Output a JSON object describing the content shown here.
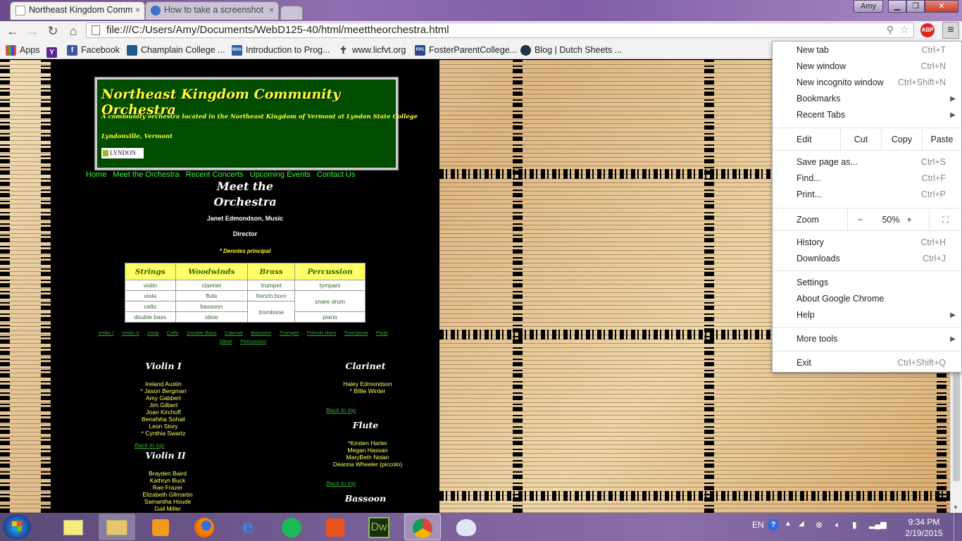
{
  "browser": {
    "tabs": [
      {
        "title": "Northeast Kingdom Comm"
      },
      {
        "title": "How to take a screenshot"
      }
    ],
    "user": "Amy",
    "url": "file:///C:/Users/Amy/Documents/WebD125-40/html/meettheorchestra.html",
    "bookmarks": [
      {
        "label": "Apps"
      },
      {
        "label": "Y"
      },
      {
        "label": "Facebook"
      },
      {
        "label": "Champlain College ..."
      },
      {
        "label": "Introduction to Prog..."
      },
      {
        "label": "www.licfvt.org"
      },
      {
        "label": "FosterParentCollege..."
      },
      {
        "label": "Blog | Dutch Sheets ..."
      }
    ]
  },
  "menu": {
    "new_tab": "New tab",
    "new_tab_sc": "Ctrl+T",
    "new_window": "New window",
    "new_window_sc": "Ctrl+N",
    "incognito": "New incognito window",
    "incognito_sc": "Ctrl+Shift+N",
    "bookmarks": "Bookmarks",
    "recent_tabs": "Recent Tabs",
    "edit": "Edit",
    "cut": "Cut",
    "copy": "Copy",
    "paste": "Paste",
    "save_page": "Save page as...",
    "save_page_sc": "Ctrl+S",
    "find": "Find...",
    "find_sc": "Ctrl+F",
    "print": "Print...",
    "print_sc": "Ctrl+P",
    "zoom": "Zoom",
    "zoom_minus": "−",
    "zoom_value": "50%",
    "zoom_plus": "+",
    "history": "History",
    "history_sc": "Ctrl+H",
    "downloads": "Downloads",
    "downloads_sc": "Ctrl+J",
    "settings": "Settings",
    "about": "About Google Chrome",
    "help": "Help",
    "more_tools": "More tools",
    "exit": "Exit",
    "exit_sc": "Ctrl+Shift+Q"
  },
  "page": {
    "title": "Northeast Kingdom Community Orchestra",
    "subtitle": "A community orchestra located in the Northeast Kingdom of Vermont at Lyndon State College",
    "location": "Lyndonville, Vermont",
    "logo_text": "LYNDON",
    "nav": [
      "Home",
      "Meet the Orchestra",
      "Recent Concerts",
      "Upcoming Events",
      "Contact Us"
    ],
    "heading_line1": "Meet the",
    "heading_line2": "Orchestra",
    "director_line1": "Janet Edmondson, Music",
    "director_line2": "Director",
    "principal_note": "* Denotes principal",
    "table_headers": [
      "Strings",
      "Woodwinds",
      "Brass",
      "Percussion"
    ],
    "table": {
      "r1": [
        "violin",
        "clarinet",
        "trumpet",
        "tympani"
      ],
      "r2": [
        "viola",
        "flute",
        "french horn"
      ],
      "snare": "snare drum",
      "r3": [
        "cello",
        "bassoon"
      ],
      "trombone": "trombone",
      "r4": [
        "double bass",
        "oboe",
        "piano"
      ]
    },
    "jump_links": [
      "Violin I",
      "Violin II",
      "Viola",
      "Cello",
      "Double Bass",
      "Clarinet",
      "Bassoon",
      "Trumpet",
      "French Horn",
      "Trombone",
      "Flute",
      "Oboe",
      "Percussion"
    ],
    "back_to_top": "Back to top",
    "violin1": {
      "heading": "Violin I",
      "names": [
        "Ireland Austin",
        "* Jason Bergman",
        "Amy Gabbert",
        "Jim Gilbert",
        "Joan Kirchoff",
        "Benafsha Sohail",
        "Leon Story",
        "* Cynthia Swartz"
      ]
    },
    "violin2": {
      "heading": "Violin II",
      "names": [
        "Brayden Baird",
        "Kathryn Buck",
        "Rae Frazer",
        "Elizabeth Gilmartin",
        "Samantha Houde",
        "Gail Miller"
      ]
    },
    "clarinet": {
      "heading": "Clarinet",
      "names": [
        "Haley Edmondson",
        "* Billie Winter"
      ]
    },
    "flute": {
      "heading": "Flute",
      "names": [
        "*Kirsten Harter",
        "Megan Hassan",
        "MaryBeth Nolan",
        "Deanna Wheeler (piccolo)"
      ]
    },
    "bassoon": {
      "heading": "Bassoon"
    }
  },
  "taskbar": {
    "lang": "EN",
    "time": "9:34 PM",
    "date": "2/19/2015",
    "dw_label": "Dw"
  }
}
